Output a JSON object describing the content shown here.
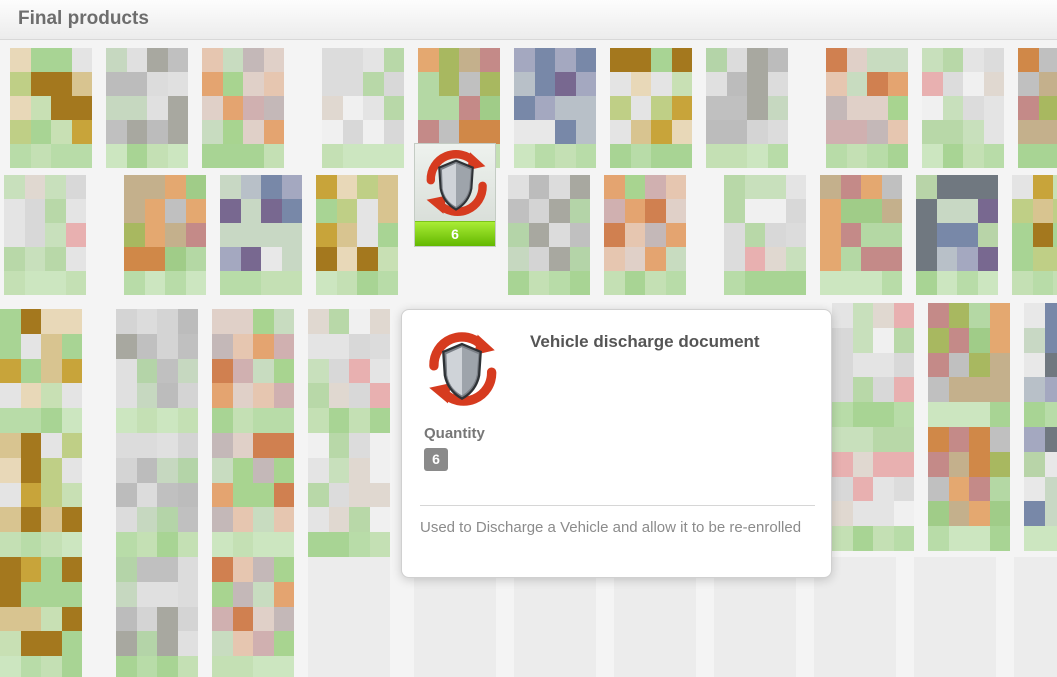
{
  "header": {
    "title": "Final products"
  },
  "featured_item": {
    "quantity": "6",
    "icon": "shield-refresh-icon"
  },
  "tooltip": {
    "title": "Vehicle discharge document",
    "quantity_label": "Quantity",
    "quantity_value": "6",
    "description": "Used to Discharge a Vehicle and allow it to be re-enrolled"
  },
  "colors": {
    "accent_green": "#8ed61c",
    "badge_gray": "#8a8a8a",
    "icon_red": "#e03a1e"
  }
}
